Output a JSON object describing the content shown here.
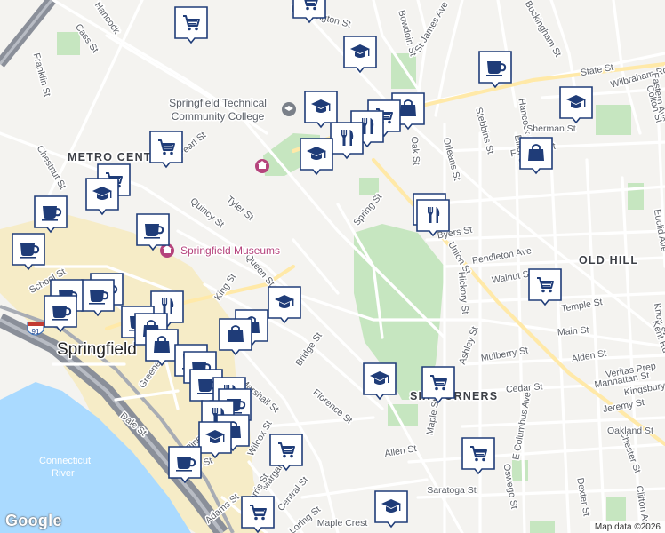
{
  "map": {
    "city_label": "Springfield",
    "districts": [
      {
        "name": "METRO CENTER",
        "text": "METRO CENT"
      },
      {
        "name": "OLD HILL",
        "text": "OLD HILL"
      },
      {
        "name": "SIX CORNERS",
        "text": "SIX CORNERS"
      }
    ],
    "pois": [
      {
        "name": "Springfield Technical Community College",
        "lines": [
          "Springfield Technical",
          "Community College"
        ]
      },
      {
        "name": "Springfield Museums",
        "lines": [
          "Springfield Museums"
        ]
      }
    ],
    "water_label": {
      "name": "Connecticut River",
      "lines": [
        "Connecticut",
        "River"
      ]
    },
    "highway_shield": "91",
    "streets": [
      "Vinton St",
      "Cass St",
      "Franklin St",
      "Worthington St",
      "Bowdoin St",
      "St James Ave",
      "Buckingham St",
      "State St",
      "Wilbraham Rd",
      "Eastern Ave",
      "Colton St",
      "Chestnut St",
      "Pearl St",
      "Stebbins St",
      "Orleans St",
      "Oak St",
      "Hancock St",
      "Quincy St",
      "Tyler St",
      "Spring St",
      "Byers St",
      "Union St",
      "Pendleton Ave",
      "Walnut St",
      "King St",
      "Queen St",
      "Temple St",
      "School St",
      "Greene St",
      "Bridge St",
      "Main St",
      "Mulberry St",
      "Alden St",
      "Ashley St",
      "Manhattan St",
      "Cedar St",
      "Marshall St",
      "Florence St",
      "Dale St",
      "Maple St",
      "E Columbus Ave",
      "Pine St",
      "Spruce St",
      "Wilcox St",
      "Margaret St",
      "Morris St",
      "Adams St",
      "Central St",
      "Loring St",
      "Saratoga St",
      "Oswego St",
      "Dexter St",
      "Clifton Ave",
      "Chester St",
      "Oakland St",
      "Allen St",
      "Hickory St",
      "Maple Crest",
      "Jeremy St",
      "Veritas Prep",
      "Euclid Ave",
      "Kingsbury St",
      "Knox St",
      "Kent Rd",
      "Fenwick St",
      "Sherman St",
      "Elliot St",
      "Hancock"
    ],
    "marker_types": [
      "shopping-cart",
      "graduation-cap",
      "coffee-cup",
      "fork-knife",
      "shopping-bag"
    ],
    "attribution": "Map data ©2026",
    "logo": "Google",
    "colors": {
      "land": "#f4f3f0",
      "downtown": "#f6ecc7",
      "park": "#c6e6c0",
      "water": "#aadaff",
      "interstate": "#8a8f99",
      "street": "#ffffff",
      "marker_border": "#1f3c78"
    }
  }
}
